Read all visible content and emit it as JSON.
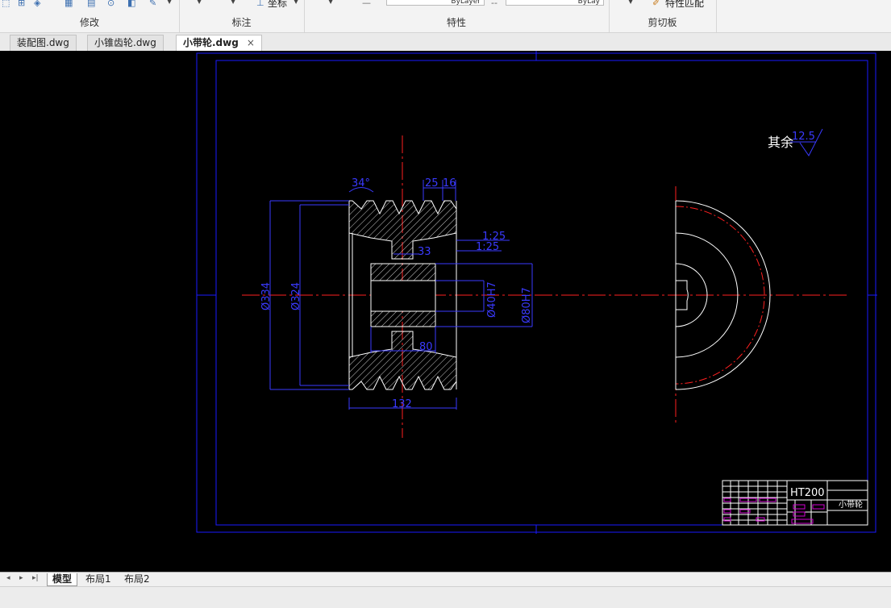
{
  "ribbon": {
    "groups": [
      {
        "label": "修改"
      },
      {
        "label": "标注"
      },
      {
        "label": "特性"
      },
      {
        "label": "剪切板"
      }
    ],
    "coord_button_label": "坐标",
    "match_props_label": "特性匹配",
    "layer_field_value": "ByLayer",
    "linetype_field_value": "ByLay"
  },
  "tabs": [
    {
      "label": "装配图.dwg",
      "active": false
    },
    {
      "label": "小锥齿轮.dwg",
      "active": false
    },
    {
      "label": "小带轮.dwg",
      "active": true
    }
  ],
  "tab_close_glyph": "×",
  "drawing": {
    "roughness_note": "其余",
    "roughness_value": "12.5",
    "dims": {
      "angle": "34°",
      "groove_pitch": "25",
      "groove_width": "16",
      "od_outer": "Ø334",
      "od_inner": "Ø324",
      "taper1": "1:25",
      "taper2": "1:25",
      "hub_dim": "33",
      "bore": "Ø40H7",
      "hub_od": "Ø80H7",
      "hub_len": "80",
      "width": "132"
    },
    "title_block": {
      "material": "HT200",
      "part_name": "小带轮"
    },
    "colors": {
      "background": "#000000",
      "frame": "#1a1aff",
      "geometry": "#ffffff",
      "centerline": "#ff2020",
      "dimension": "#3a3aff",
      "title_block_magenta": "#d000d0"
    }
  },
  "layout_nav": [
    "◂",
    "▸",
    "▸|"
  ],
  "layout_tabs": [
    {
      "label": "模型",
      "active": true
    },
    {
      "label": "布局1",
      "active": false
    },
    {
      "label": "布局2",
      "active": false
    }
  ]
}
